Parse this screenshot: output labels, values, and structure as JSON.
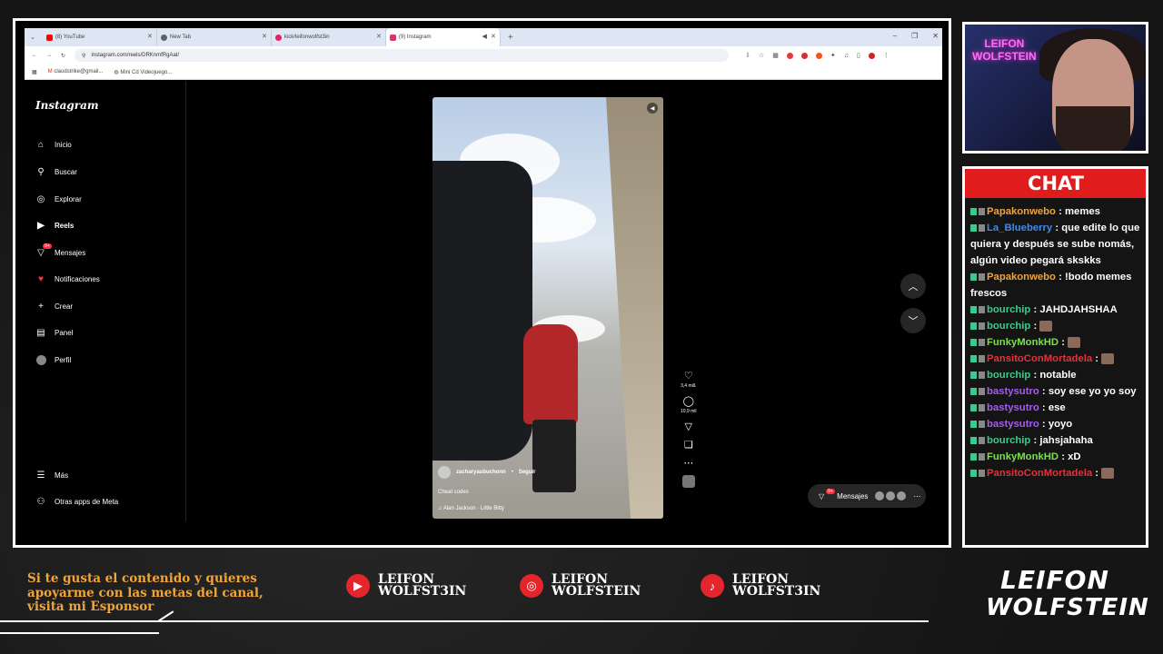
{
  "browser": {
    "tabs": [
      {
        "label": "(8) YouTube",
        "color": "#ff0000"
      },
      {
        "label": "New Tab",
        "color": "#5f6368"
      },
      {
        "label": "kick/leifonwolfst3in",
        "color": "#e91e63"
      },
      {
        "label": "(9) Instagram",
        "color": "#e1306c"
      }
    ],
    "url": "instagram.com/reels/DRKnmfRgAat/",
    "bookmarks": [
      "claudstrike@gmail...",
      "Mini Cd Videojuego..."
    ]
  },
  "instagram": {
    "logo": "Instagram",
    "nav": [
      {
        "label": "Inicio",
        "icon": "home-icon"
      },
      {
        "label": "Buscar",
        "icon": "search-icon"
      },
      {
        "label": "Explorar",
        "icon": "compass-icon"
      },
      {
        "label": "Reels",
        "icon": "reels-icon"
      },
      {
        "label": "Mensajes",
        "icon": "messenger-icon",
        "badge": "9+"
      },
      {
        "label": "Notificaciones",
        "icon": "heart-icon"
      },
      {
        "label": "Crear",
        "icon": "plus-icon"
      },
      {
        "label": "Panel",
        "icon": "dashboard-icon"
      },
      {
        "label": "Perfil",
        "icon": "avatar-icon"
      }
    ],
    "nav_bottom": [
      {
        "label": "Más",
        "icon": "menu-icon"
      },
      {
        "label": "Otras apps de Meta",
        "icon": "meta-apps-icon"
      }
    ],
    "reel": {
      "username": "zacharyaubuchonn",
      "follow": "Seguir",
      "caption": "Cheat codes",
      "audio": "Alan Jackson · Little Bitty",
      "likes": "3,4 mill.",
      "comments": "10,9 mil"
    },
    "messages_button": "Mensajes",
    "messages_badge": "9+"
  },
  "webcam": {
    "neon_line1": "LEIFON",
    "neon_line2": "WOLFSTEIN"
  },
  "chat": {
    "title": "CHAT",
    "partial_top": "memes",
    "messages": [
      {
        "user": "Papakonwebo",
        "color": "#f0a43a",
        "text": "memes"
      },
      {
        "user": "La_Blueberry",
        "color": "#3b8cf0",
        "text": "que edite lo que quiera y después se sube nomás, algún video pegará skskks"
      },
      {
        "user": "Papakonwebo",
        "color": "#f0a43a",
        "text": "!bodo memes frescos"
      },
      {
        "user": "bourchip",
        "color": "#3ec98e",
        "text": "JAHDJAHSHAA"
      },
      {
        "user": "bourchip",
        "color": "#3ec98e",
        "text": "",
        "emote": true
      },
      {
        "user": "FunkyMonkHD",
        "color": "#7be04a",
        "text": "",
        "emote": true
      },
      {
        "user": "PansitoConMortadela",
        "color": "#e0343a",
        "text": "",
        "emote": true
      },
      {
        "user": "bourchip",
        "color": "#3ec98e",
        "text": "notable"
      },
      {
        "user": "bastysutro",
        "color": "#a55cf0",
        "text": "soy ese yo yo soy"
      },
      {
        "user": "bastysutro",
        "color": "#a55cf0",
        "text": "ese"
      },
      {
        "user": "bastysutro",
        "color": "#a55cf0",
        "text": "yoyo"
      },
      {
        "user": "bourchip",
        "color": "#3ec98e",
        "text": "jahsjahaha"
      },
      {
        "user": "FunkyMonkHD",
        "color": "#7be04a",
        "text": "xD"
      },
      {
        "user": "PansitoConMortadela",
        "color": "#e0343a",
        "text": "",
        "emote": true
      }
    ]
  },
  "footer": {
    "promo": "Si te gusta el contenido y quieres apoyarme con las metas del canal, visita mi Esponsor",
    "socials": [
      {
        "platform": "youtube-icon",
        "line1": "LEIFON",
        "line2": "WOLFST3IN"
      },
      {
        "platform": "instagram-icon",
        "line1": "LEIFON",
        "line2": "WOLFSTEIN"
      },
      {
        "platform": "tiktok-icon",
        "line1": "LEIFON",
        "line2": "WOLFST3IN"
      }
    ],
    "brand_line1": "LEIFON",
    "brand_line2": "WOLFSTEIN"
  }
}
